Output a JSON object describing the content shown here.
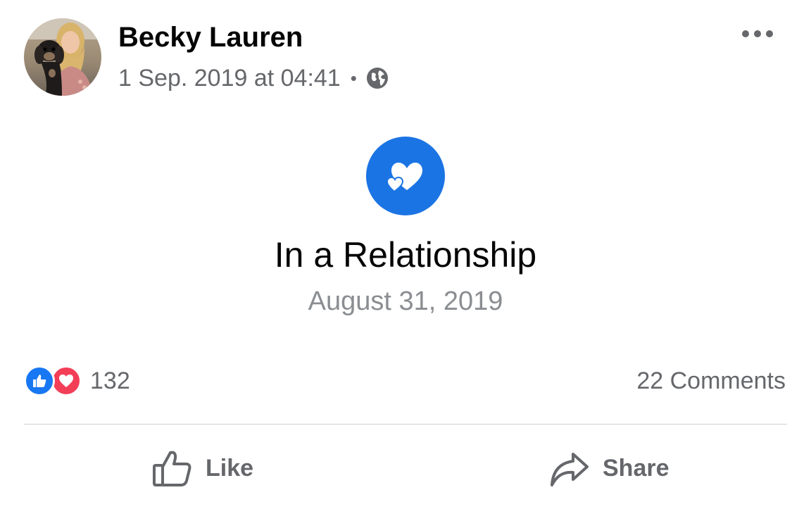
{
  "post": {
    "author": {
      "name": "Becky Lauren",
      "avatar_icon": "profile-photo"
    },
    "timestamp": "1 Sep. 2019 at 04:41",
    "separator": "•",
    "privacy_icon": "globe-icon",
    "more_icon": "more-horizontal-icon",
    "life_event": {
      "icon": "hearts-icon",
      "icon_color": "#1b74e4",
      "title": "In a Relationship",
      "date": "August 31, 2019"
    },
    "stats": {
      "reaction_icons": [
        "like-reaction-icon",
        "love-reaction-icon"
      ],
      "reaction_count": "132",
      "comments": "22 Comments"
    },
    "actions": {
      "like_label": "Like",
      "share_label": "Share"
    }
  },
  "colors": {
    "accent": "#1877f2",
    "love": "#f33e58",
    "text_primary": "#050505",
    "text_secondary": "#65676b"
  }
}
